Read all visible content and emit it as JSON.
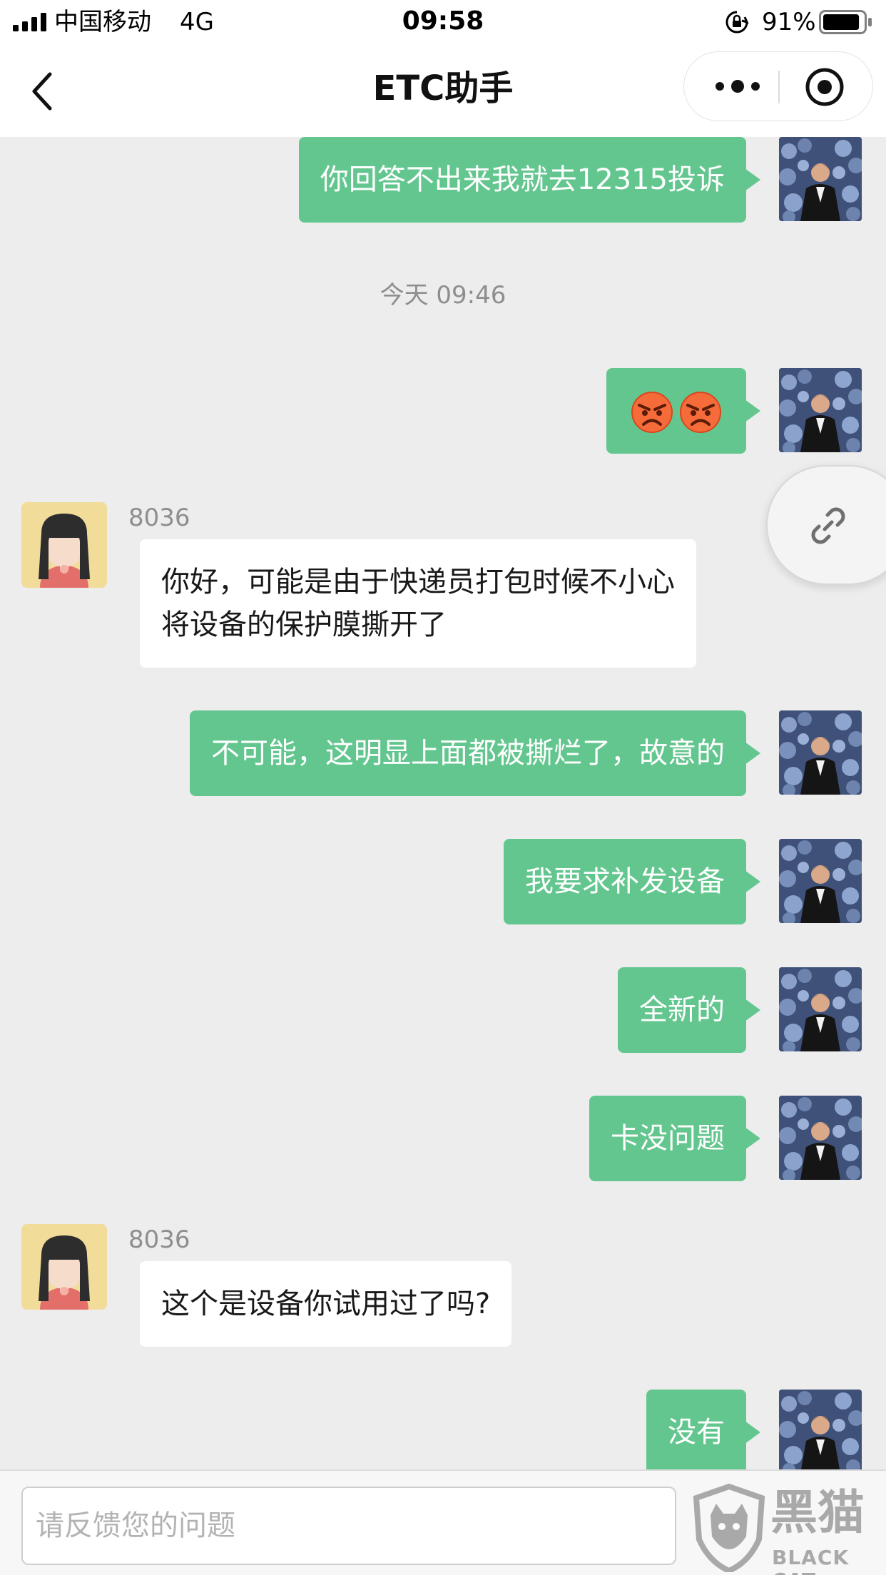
{
  "status_bar": {
    "carrier": "中国移动",
    "network": "4G",
    "time": "09:58",
    "battery": "91%",
    "battery_level": 0.91,
    "icons": [
      "signal-icon",
      "orientation-lock-icon",
      "battery-icon"
    ]
  },
  "nav": {
    "title": "ETC助手",
    "icons": [
      "back-icon",
      "more-icon",
      "close-target-icon"
    ]
  },
  "messages": [
    {
      "from": "me",
      "text": "你回答不出来我就去12315投诉"
    },
    {
      "type": "timestamp",
      "text": "今天 09:46"
    },
    {
      "from": "me",
      "emoji": [
        "angry-face-icon",
        "angry-face-icon"
      ]
    },
    {
      "from": "agent",
      "name": "8036",
      "lines": [
        "你好，可能是由于快递员打包时候不小心",
        "将设备的保护膜撕开了"
      ]
    },
    {
      "from": "me",
      "text": "不可能，这明显上面都被撕烂了，故意的"
    },
    {
      "from": "me",
      "text": "我要求补发设备"
    },
    {
      "from": "me",
      "text": "全新的"
    },
    {
      "from": "me",
      "text": "卡没问题"
    },
    {
      "from": "agent",
      "name": "8036",
      "lines": [
        "这个是设备你试用过了吗?"
      ]
    },
    {
      "from": "me",
      "text": "没有"
    }
  ],
  "floating_link": {
    "icon": "link-icon"
  },
  "input": {
    "placeholder": "请反馈您的问题",
    "value": ""
  },
  "watermark": {
    "cn": "黑猫",
    "en": "BLACK CAT"
  },
  "colors": {
    "my_bubble": "#64c68f",
    "agent_bubble": "#ffffff",
    "background": "#ededed"
  }
}
